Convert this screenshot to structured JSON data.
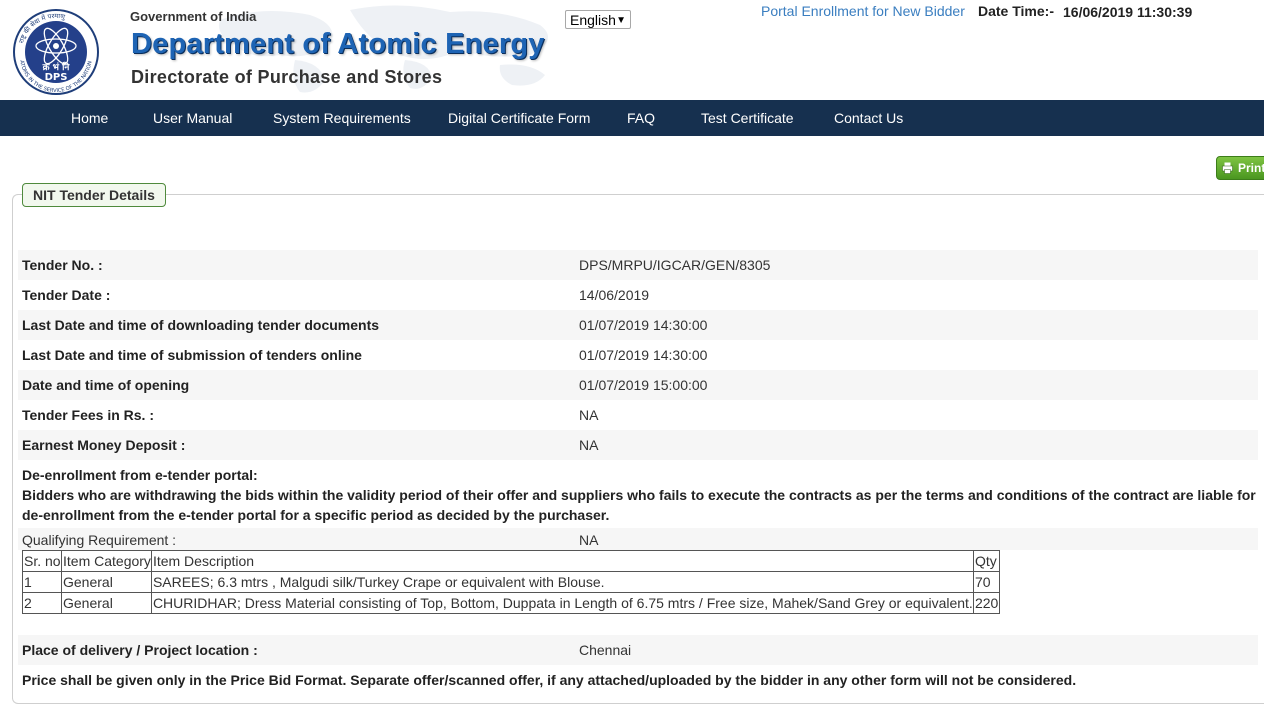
{
  "header": {
    "government": "Government of India",
    "department": "Department of Atomic Energy",
    "directorate": "Directorate of Purchase and Stores",
    "logo_hindi_top": "राष्ट्र की सेवा में परमाणु",
    "logo_hindi_mid": "क्र भं नि",
    "logo_abbr": "DPS",
    "logo_motto": "ATOMS IN THE SERVICE OF THE NATION",
    "language": "English",
    "portal_link": "Portal Enrollment for New Bidder",
    "datetime_label": "Date Time:-",
    "datetime_value": "16/06/2019 11:30:39"
  },
  "nav": {
    "items": [
      "Home",
      "User Manual",
      "System Requirements",
      "Digital Certificate Form",
      "FAQ",
      "Test Certificate",
      "Contact Us"
    ]
  },
  "print_label": "Print",
  "section_title": "NIT Tender Details",
  "details": [
    {
      "label": "Tender No. :",
      "value": "DPS/MRPU/IGCAR/GEN/8305"
    },
    {
      "label": "Tender Date :",
      "value": "14/06/2019"
    },
    {
      "label": "Last Date and time of downloading tender documents",
      "value": "01/07/2019 14:30:00"
    },
    {
      "label": "Last Date and time of submission of tenders online",
      "value": "01/07/2019 14:30:00"
    },
    {
      "label": "Date and time of opening",
      "value": "01/07/2019 15:00:00"
    },
    {
      "label": "Tender Fees in Rs. :",
      "value": "NA"
    },
    {
      "label": "Earnest Money Deposit :",
      "value": "NA"
    }
  ],
  "deenroll": {
    "title": "De-enrollment from e-tender portal:",
    "line1": "Bidders who are withdrawing the bids within the validity period of their offer and suppliers who fails to execute the contracts as per the terms and conditions of the contract are liable for",
    "line2": "de-enrollment from the e-tender portal for a specific period as decided by the purchaser."
  },
  "qualifying": {
    "label": "Qualifying Requirement :",
    "value": "NA"
  },
  "items_table": {
    "headers": [
      "Sr. no",
      "Item Category",
      "Item Description",
      "Qty"
    ],
    "rows": [
      [
        "1",
        "General",
        "SAREES; 6.3 mtrs , Malgudi silk/Turkey Crape or equivalent with Blouse.",
        "70"
      ],
      [
        "2",
        "General",
        "CHURIDHAR; Dress Material consisting of Top, Bottom, Duppata in Length of 6.75 mtrs / Free size, Mahek/Sand Grey or equivalent.",
        "220"
      ]
    ]
  },
  "delivery": {
    "label": "Place of delivery / Project location :",
    "value": "Chennai"
  },
  "price_note": "Price shall be given only in the Price Bid Format. Separate offer/scanned offer, if any attached/uploaded by the bidder in any other form will not be considered.",
  "colors": {
    "nav_bg": "#16304f",
    "dept_blue": "#1e64b4",
    "link_blue": "#3a7ec0",
    "print_green": "#5aa82a"
  }
}
